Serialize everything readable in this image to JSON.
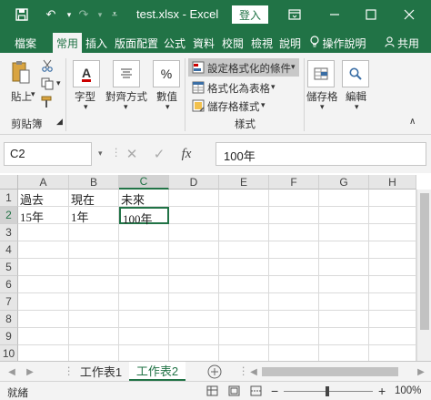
{
  "titlebar": {
    "title": "test.xlsx  -  Excel",
    "login_label": "登入"
  },
  "tabs": [
    "檔案",
    "常用",
    "插入",
    "版面配置",
    "公式",
    "資料",
    "校閱",
    "檢視",
    "說明"
  ],
  "tabs_right": {
    "tell_me": "操作說明",
    "share": "共用"
  },
  "ribbon": {
    "paste": "貼上",
    "clipboard_group": "剪貼簿",
    "font": "字型",
    "alignment": "對齊方式",
    "number": "數值",
    "conditional_formatting": "設定格式化的條件",
    "format_as_table": "格式化為表格",
    "cell_styles": "儲存格樣式",
    "styles_group": "樣式",
    "cells": "儲存格",
    "editing": "編輯"
  },
  "formula_bar": {
    "name_box": "C2",
    "formula": "100年"
  },
  "grid": {
    "columns": [
      "A",
      "B",
      "C",
      "D",
      "E",
      "F",
      "G",
      "H"
    ],
    "rows": [
      "1",
      "2",
      "3",
      "4",
      "5",
      "6",
      "7",
      "8",
      "9",
      "10"
    ],
    "cells": {
      "A1": "過去",
      "B1": "現在",
      "C1": "未來",
      "A2": "15年",
      "B2": "1年",
      "C2": "100年"
    },
    "selected_cell": "C2"
  },
  "sheets": [
    "工作表1",
    "工作表2"
  ],
  "active_sheet": "工作表2",
  "status": {
    "ready": "就緒",
    "zoom": "100%"
  },
  "colors": {
    "accent": "#217346"
  }
}
